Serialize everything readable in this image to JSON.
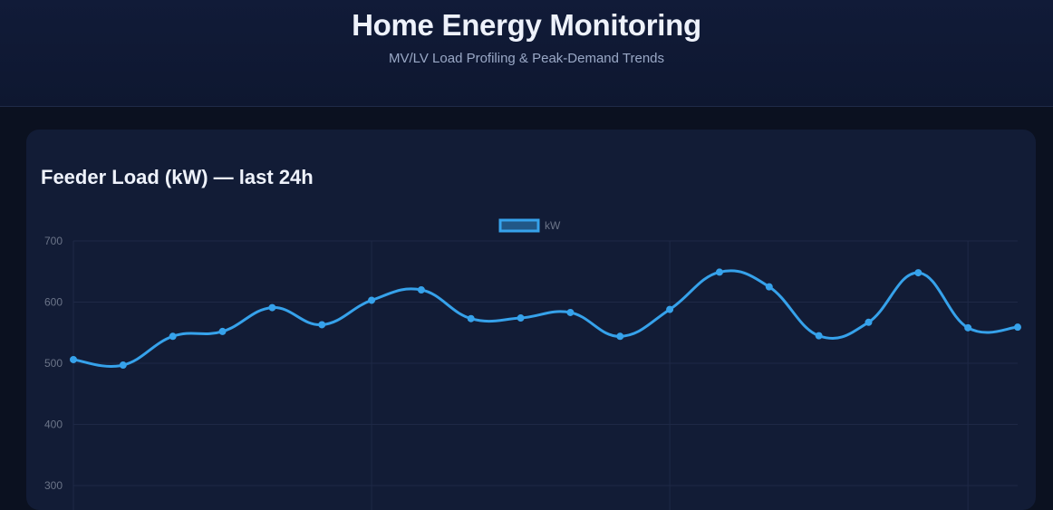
{
  "header": {
    "title": "Home Energy Monitoring",
    "subtitle": "MV/LV Load Profiling & Peak-Demand Trends"
  },
  "card": {
    "title": "Feeder Load (kW) — last 24h"
  },
  "colors": {
    "line": "#36a2eb",
    "background": "#0b1120",
    "card": "#121c36",
    "grid": "#1e2946",
    "tick": "#6b7488"
  },
  "chart_data": {
    "type": "line",
    "title": "Feeder Load (kW) — last 24h",
    "legend": [
      "kW"
    ],
    "legend_position": "top",
    "ylim": [
      300,
      700
    ],
    "yticks": [
      300,
      400,
      500,
      600,
      700
    ],
    "grid": true,
    "series": [
      {
        "name": "kW",
        "values": [
          506,
          497,
          544,
          552,
          591,
          563,
          603,
          620,
          573,
          574,
          583,
          544,
          588,
          649,
          625,
          545,
          567,
          648,
          558,
          559
        ]
      }
    ]
  }
}
